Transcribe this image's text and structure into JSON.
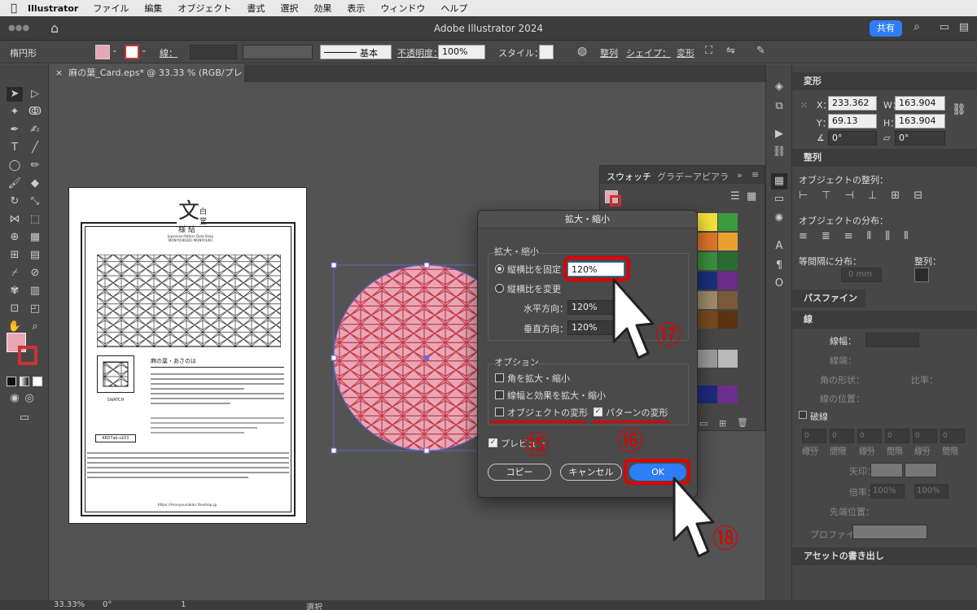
{
  "menubar": {
    "app_name": "Illustrator",
    "items": [
      "ファイル",
      "編集",
      "オブジェクト",
      "書式",
      "選択",
      "効果",
      "表示",
      "ウィンドウ",
      "ヘルプ"
    ]
  },
  "titlebar": {
    "title": "Adobe Illustrator 2024",
    "share_label": "共有"
  },
  "control": {
    "object_type": "楕円形",
    "stroke_label": "線：",
    "stroke_style": "基本",
    "opacity_label": "不透明度：",
    "opacity_value": "100%",
    "style_label": "スタイル：",
    "align_label": "整列",
    "shape_label": "シェイプ：",
    "transform_label": "変形"
  },
  "document_tab": {
    "label": "麻の葉_Card.eps* @ 33.33 % (RGB/プレビュー)"
  },
  "transform_panel": {
    "title": "変形",
    "x_label": "X：",
    "x_value": "233.362 m",
    "y_label": "Y：",
    "y_value": "69.13 mm",
    "w_label": "W：",
    "w_value": "163.904 m",
    "h_label": "H：",
    "h_value": "163.904 m",
    "angle_value": "0°",
    "shear_value": "0°"
  },
  "align_panel": {
    "title": "整列",
    "align_objects_label": "オブジェクトの整列：",
    "distribute_objects_label": "オブジェクトの分布：",
    "distribute_spacing_label": "等間隔に分布：",
    "align_to_label": "整列：",
    "spacing_value": "0 mm"
  },
  "pathfinder_panel": {
    "title": "パスファインダー"
  },
  "stroke_panel": {
    "title": "線",
    "weight_label": "線幅：",
    "cap_label": "線端：",
    "corner_label": "角の形状：",
    "limit_label": "比率：",
    "align_label": "線の位置：",
    "dashed_label": "破線",
    "dash_labels": [
      "線分",
      "間隔",
      "線分",
      "間隔",
      "線分",
      "間隔"
    ],
    "dash_value": "0 mm",
    "arrow_label": "矢印：",
    "scale_label": "倍率：",
    "scale_value": "100%",
    "tip_label": "先端位置：",
    "profile_label": "プロファイル："
  },
  "asset_panel": {
    "title": "アセットの書き出し"
  },
  "swatches_panel": {
    "tabs": [
      "スウォッチ",
      "グラデー",
      "アピアラ"
    ],
    "colors": [
      "#f4e23b",
      "#3a9a3c",
      "#e0762a",
      "#e8a031",
      "#3b8f3d",
      "#2a6b34",
      "#1d2d7a",
      "#6a2c86",
      "#a08a6a",
      "#7a5a3a",
      "#7a4a1e",
      "#5b3214",
      "#9a9a9a",
      "#b9b9b9",
      "#1e2a7c",
      "#6d2f8e"
    ]
  },
  "dialog": {
    "title": "拡大・縮小",
    "scale_group_label": "拡大・縮小",
    "uniform_label": "縦横比を固定",
    "uniform_value": "120%",
    "non_uniform_label": "縦横比を変更",
    "horizontal_label": "水平方向：",
    "horizontal_value": "120%",
    "vertical_label": "垂直方向：",
    "vertical_value": "120%",
    "options_label": "オプション",
    "scale_corners_label": "角を拡大・縮小",
    "scale_strokes_label": "線幅と効果を拡大・縮小",
    "transform_objects_label": "オブジェクトの変形",
    "transform_patterns_label": "パターンの変形",
    "preview_label": "プレビュー",
    "copy_label": "コピー",
    "cancel_label": "キャンセル",
    "ok_label": "OK"
  },
  "annotations": {
    "n15": "⑮",
    "n16": "⑯",
    "n17": "⑰",
    "n18": "⑱"
  },
  "card": {
    "logo_char": "文",
    "logo_side": "白",
    "logo_side2": "堂",
    "logo_sub1": "様",
    "logo_sub2": "結",
    "brand_en": "Japanese Pattern Data Shop",
    "brand_en2": "MONYOUKUDO MONYOUKU",
    "swatch_label": "SWATCH",
    "heading": "麻の葉・あさのは",
    "code": "KK07ab-s101",
    "url": "https://monyousakan.theshop.jp"
  },
  "status": {
    "zoom": "33.33%",
    "angle": "0°",
    "page": "1",
    "mode": "選択"
  }
}
